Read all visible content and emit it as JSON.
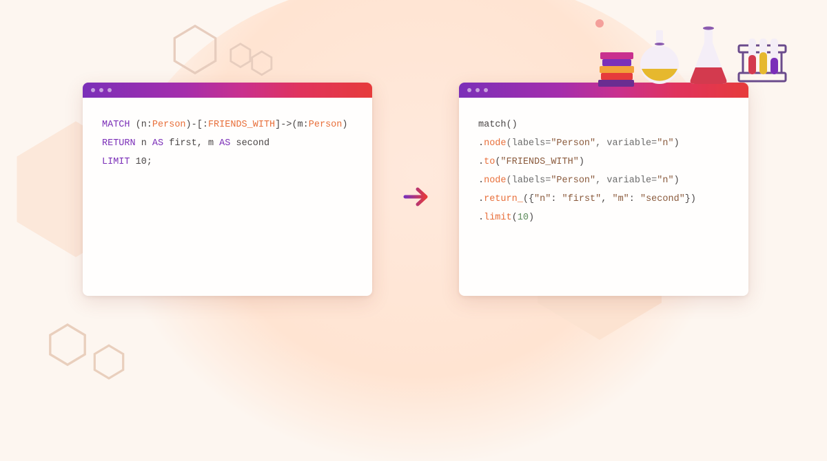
{
  "left_panel": {
    "code_lines": [
      {
        "tokens": [
          {
            "t": "MATCH ",
            "c": "kw"
          },
          {
            "t": "(n:",
            "c": ""
          },
          {
            "t": "Person",
            "c": "lbl"
          },
          {
            "t": ")-[:",
            "c": ""
          },
          {
            "t": "FRIENDS_WITH",
            "c": "lbl"
          },
          {
            "t": "]->(m:",
            "c": ""
          },
          {
            "t": "Person",
            "c": "lbl"
          },
          {
            "t": ")",
            "c": ""
          }
        ]
      },
      {
        "tokens": [
          {
            "t": "RETURN ",
            "c": "kw"
          },
          {
            "t": "n ",
            "c": ""
          },
          {
            "t": "AS ",
            "c": "kw"
          },
          {
            "t": "first, m ",
            "c": ""
          },
          {
            "t": "AS ",
            "c": "kw"
          },
          {
            "t": "second",
            "c": ""
          }
        ]
      },
      {
        "tokens": [
          {
            "t": "LIMIT ",
            "c": "kw"
          },
          {
            "t": "10;",
            "c": ""
          }
        ]
      }
    ]
  },
  "right_panel": {
    "code_lines": [
      {
        "tokens": [
          {
            "t": "match()",
            "c": ""
          }
        ]
      },
      {
        "tokens": [
          {
            "t": ".",
            "c": ""
          },
          {
            "t": "node",
            "c": "meth"
          },
          {
            "t": "(labels=",
            "c": "param"
          },
          {
            "t": "\"Person\"",
            "c": "str"
          },
          {
            "t": ", variable=",
            "c": "param"
          },
          {
            "t": "\"n\"",
            "c": "str"
          },
          {
            "t": ")",
            "c": ""
          }
        ]
      },
      {
        "tokens": [
          {
            "t": ".",
            "c": ""
          },
          {
            "t": "to",
            "c": "meth"
          },
          {
            "t": "(",
            "c": ""
          },
          {
            "t": "\"FRIENDS_WITH\"",
            "c": "str"
          },
          {
            "t": ")",
            "c": ""
          }
        ]
      },
      {
        "tokens": [
          {
            "t": ".",
            "c": ""
          },
          {
            "t": "node",
            "c": "meth"
          },
          {
            "t": "(labels=",
            "c": "param"
          },
          {
            "t": "\"Person\"",
            "c": "str"
          },
          {
            "t": ", variable=",
            "c": "param"
          },
          {
            "t": "\"n\"",
            "c": "str"
          },
          {
            "t": ")",
            "c": ""
          }
        ]
      },
      {
        "tokens": [
          {
            "t": ".",
            "c": ""
          },
          {
            "t": "return_",
            "c": "meth"
          },
          {
            "t": "({",
            "c": ""
          },
          {
            "t": "\"n\"",
            "c": "str"
          },
          {
            "t": ": ",
            "c": ""
          },
          {
            "t": "\"first\"",
            "c": "str"
          },
          {
            "t": ", ",
            "c": ""
          },
          {
            "t": "\"m\"",
            "c": "str"
          },
          {
            "t": ": ",
            "c": ""
          },
          {
            "t": "\"second\"",
            "c": "str"
          },
          {
            "t": "})",
            "c": ""
          }
        ]
      },
      {
        "tokens": [
          {
            "t": ".",
            "c": ""
          },
          {
            "t": "limit",
            "c": "meth"
          },
          {
            "t": "(",
            "c": ""
          },
          {
            "t": "10",
            "c": "num"
          },
          {
            "t": ")",
            "c": ""
          }
        ]
      }
    ]
  },
  "colors": {
    "gradient_start": "#7B2FB8",
    "gradient_end": "#E63B3B",
    "accent_orange": "#E86F3A"
  }
}
